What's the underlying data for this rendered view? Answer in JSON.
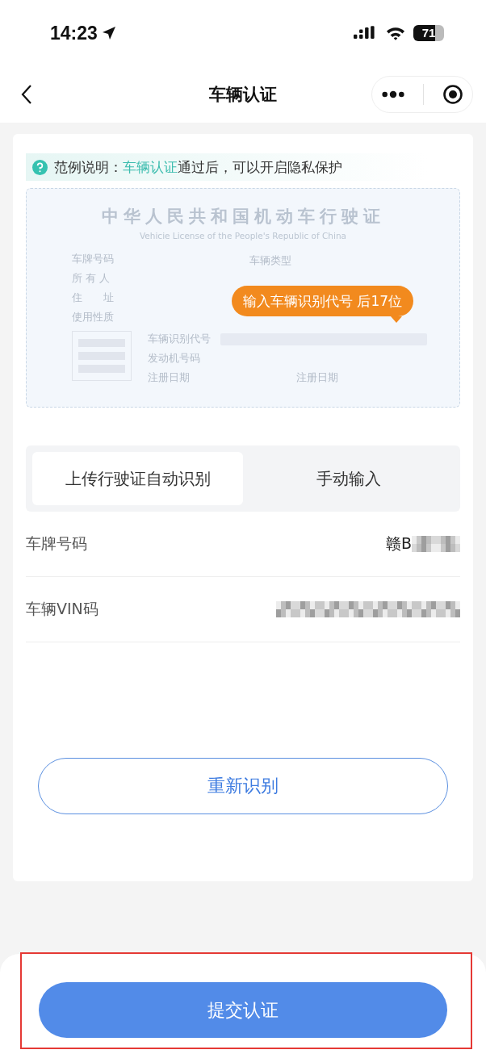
{
  "status_bar": {
    "time": "14:23",
    "battery": "71"
  },
  "nav": {
    "title": "车辆认证"
  },
  "hint": {
    "prefix": "范例说明：",
    "link": "车辆认证",
    "suffix": "通过后，可以开启隐私保护"
  },
  "license_sample": {
    "title": "中华人民共和国机动车行驶证",
    "subtitle": "Vehicie License of the People's Republic of China",
    "left_labels": [
      "车牌号码",
      "所 有 人",
      "住　　址",
      "使用性质"
    ],
    "right_label": "车辆类型",
    "mid_labels": [
      "车辆识别代号",
      "发动机号码",
      "注册日期"
    ],
    "right_bottom_label": "注册日期",
    "tooltip": "输入车辆识别代号 后17位"
  },
  "tabs": [
    {
      "label": "上传行驶证自动识别",
      "selected": true
    },
    {
      "label": "手动输入",
      "selected": false
    }
  ],
  "fields": [
    {
      "label": "车牌号码",
      "value": "赣B",
      "masked": true
    },
    {
      "label": "车辆VIN码",
      "masked": true
    }
  ],
  "rescan_button": "重新识别",
  "submit_button": "提交认证",
  "annotation": {
    "highlighted": true
  }
}
